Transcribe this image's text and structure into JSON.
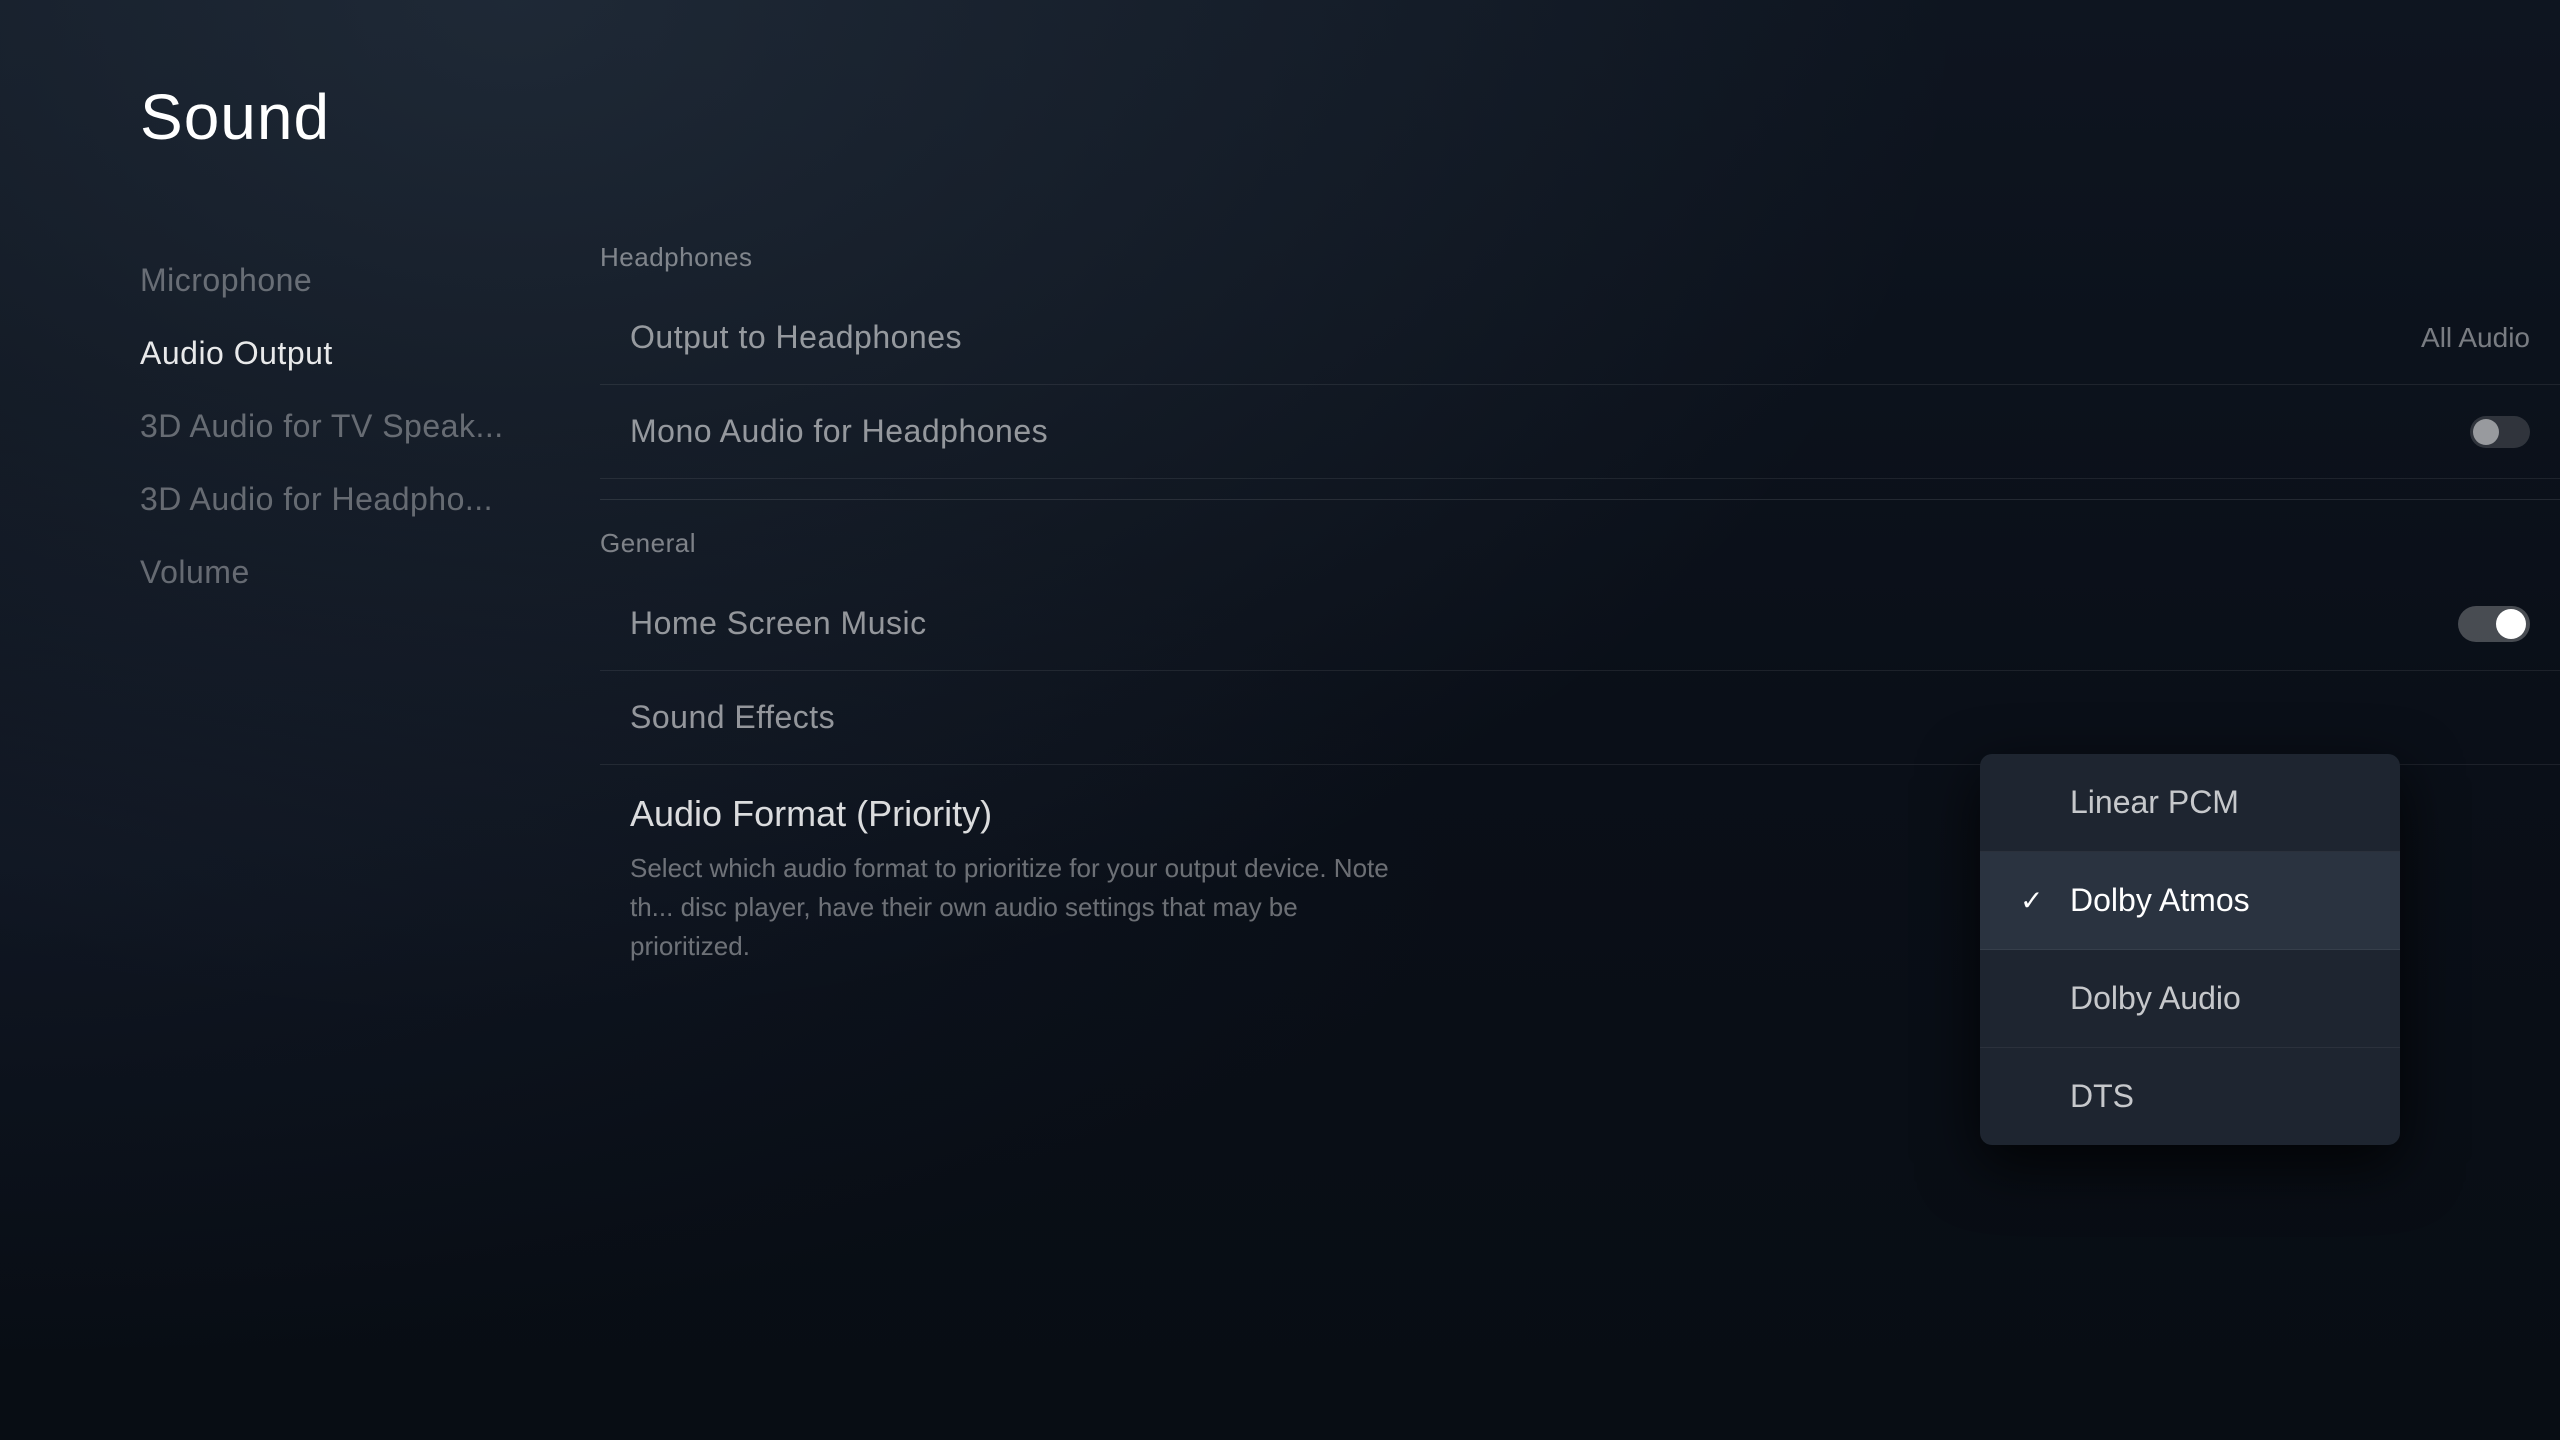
{
  "page": {
    "title": "Sound"
  },
  "nav": {
    "items": [
      {
        "id": "microphone",
        "label": "Microphone",
        "active": false
      },
      {
        "id": "audio-output",
        "label": "Audio Output",
        "active": true
      },
      {
        "id": "3d-audio-tv",
        "label": "3D Audio for TV Speak...",
        "active": false
      },
      {
        "id": "3d-audio-headphones",
        "label": "3D Audio for Headpho...",
        "active": false
      },
      {
        "id": "volume",
        "label": "Volume",
        "active": false
      }
    ]
  },
  "content": {
    "sections": [
      {
        "id": "headphones",
        "label": "Headphones",
        "settings": [
          {
            "id": "output-to-headphones",
            "name": "Output to Headphones",
            "value": "All Audio",
            "type": "value"
          },
          {
            "id": "mono-audio",
            "name": "Mono Audio for Headphones",
            "value": "",
            "type": "toggle-off"
          }
        ]
      },
      {
        "id": "general",
        "label": "General",
        "settings": [
          {
            "id": "home-screen-music",
            "name": "Home Screen Music",
            "value": "",
            "type": "toggle-on"
          },
          {
            "id": "sound-effects",
            "name": "Sound Effects",
            "value": "",
            "type": "none"
          }
        ]
      }
    ],
    "audio_format": {
      "title": "Audio Format (Priority)",
      "description": "Select which audio format to prioritize for your output device. Note th... disc player, have their own audio settings that may be prioritized."
    }
  },
  "dropdown": {
    "items": [
      {
        "id": "linear-pcm",
        "label": "Linear PCM",
        "selected": false
      },
      {
        "id": "dolby-atmos",
        "label": "Dolby Atmos",
        "selected": true
      },
      {
        "id": "dolby-audio",
        "label": "Dolby Audio",
        "selected": false
      },
      {
        "id": "dts",
        "label": "DTS",
        "selected": false
      }
    ]
  }
}
